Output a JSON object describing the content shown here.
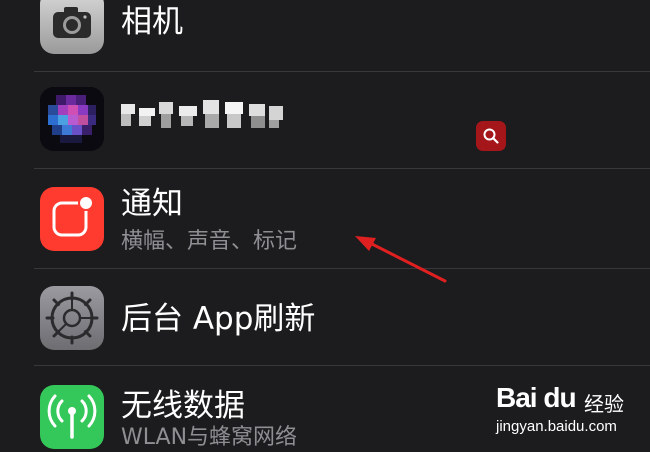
{
  "rows": [
    {
      "title": "相机",
      "icon": "camera-icon"
    },
    {
      "title": "",
      "icon": "siri-icon",
      "obscured": true
    },
    {
      "title": "通知",
      "subtitle": "横幅、声音、标记",
      "icon": "notifications-icon"
    },
    {
      "title": "后台 App刷新",
      "icon": "gear-icon"
    },
    {
      "title": "无线数据",
      "subtitle": "WLAN与蜂窝网络",
      "icon": "antenna-icon"
    }
  ],
  "colors": {
    "background": "#1c1c1e",
    "separator": "#38383a",
    "notification_red": "#ff3b30",
    "cellular_green": "#34c759",
    "arrow_red": "#e02020"
  },
  "watermark": {
    "brand": "Bai du",
    "experience": "经验",
    "url": "jingyan.baidu.com"
  }
}
